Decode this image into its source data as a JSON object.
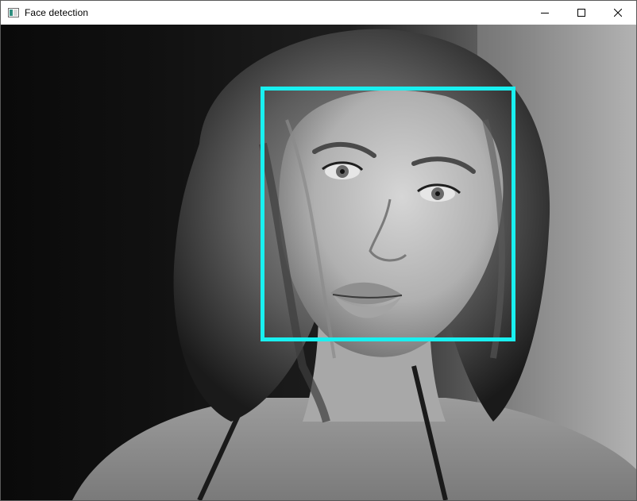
{
  "window": {
    "title": "Face detection",
    "app_icon": "opencv-window-icon",
    "controls": [
      "minimize-icon",
      "maximize-icon",
      "close-icon"
    ]
  },
  "image": {
    "description_colors": {
      "background": "#2a2a2a",
      "highlight": "#cfcfcf",
      "shadow": "#0c0c0c"
    },
    "grayscale": true
  },
  "detection": {
    "label": "face",
    "box_color": "#19f0f0",
    "count": 1
  }
}
